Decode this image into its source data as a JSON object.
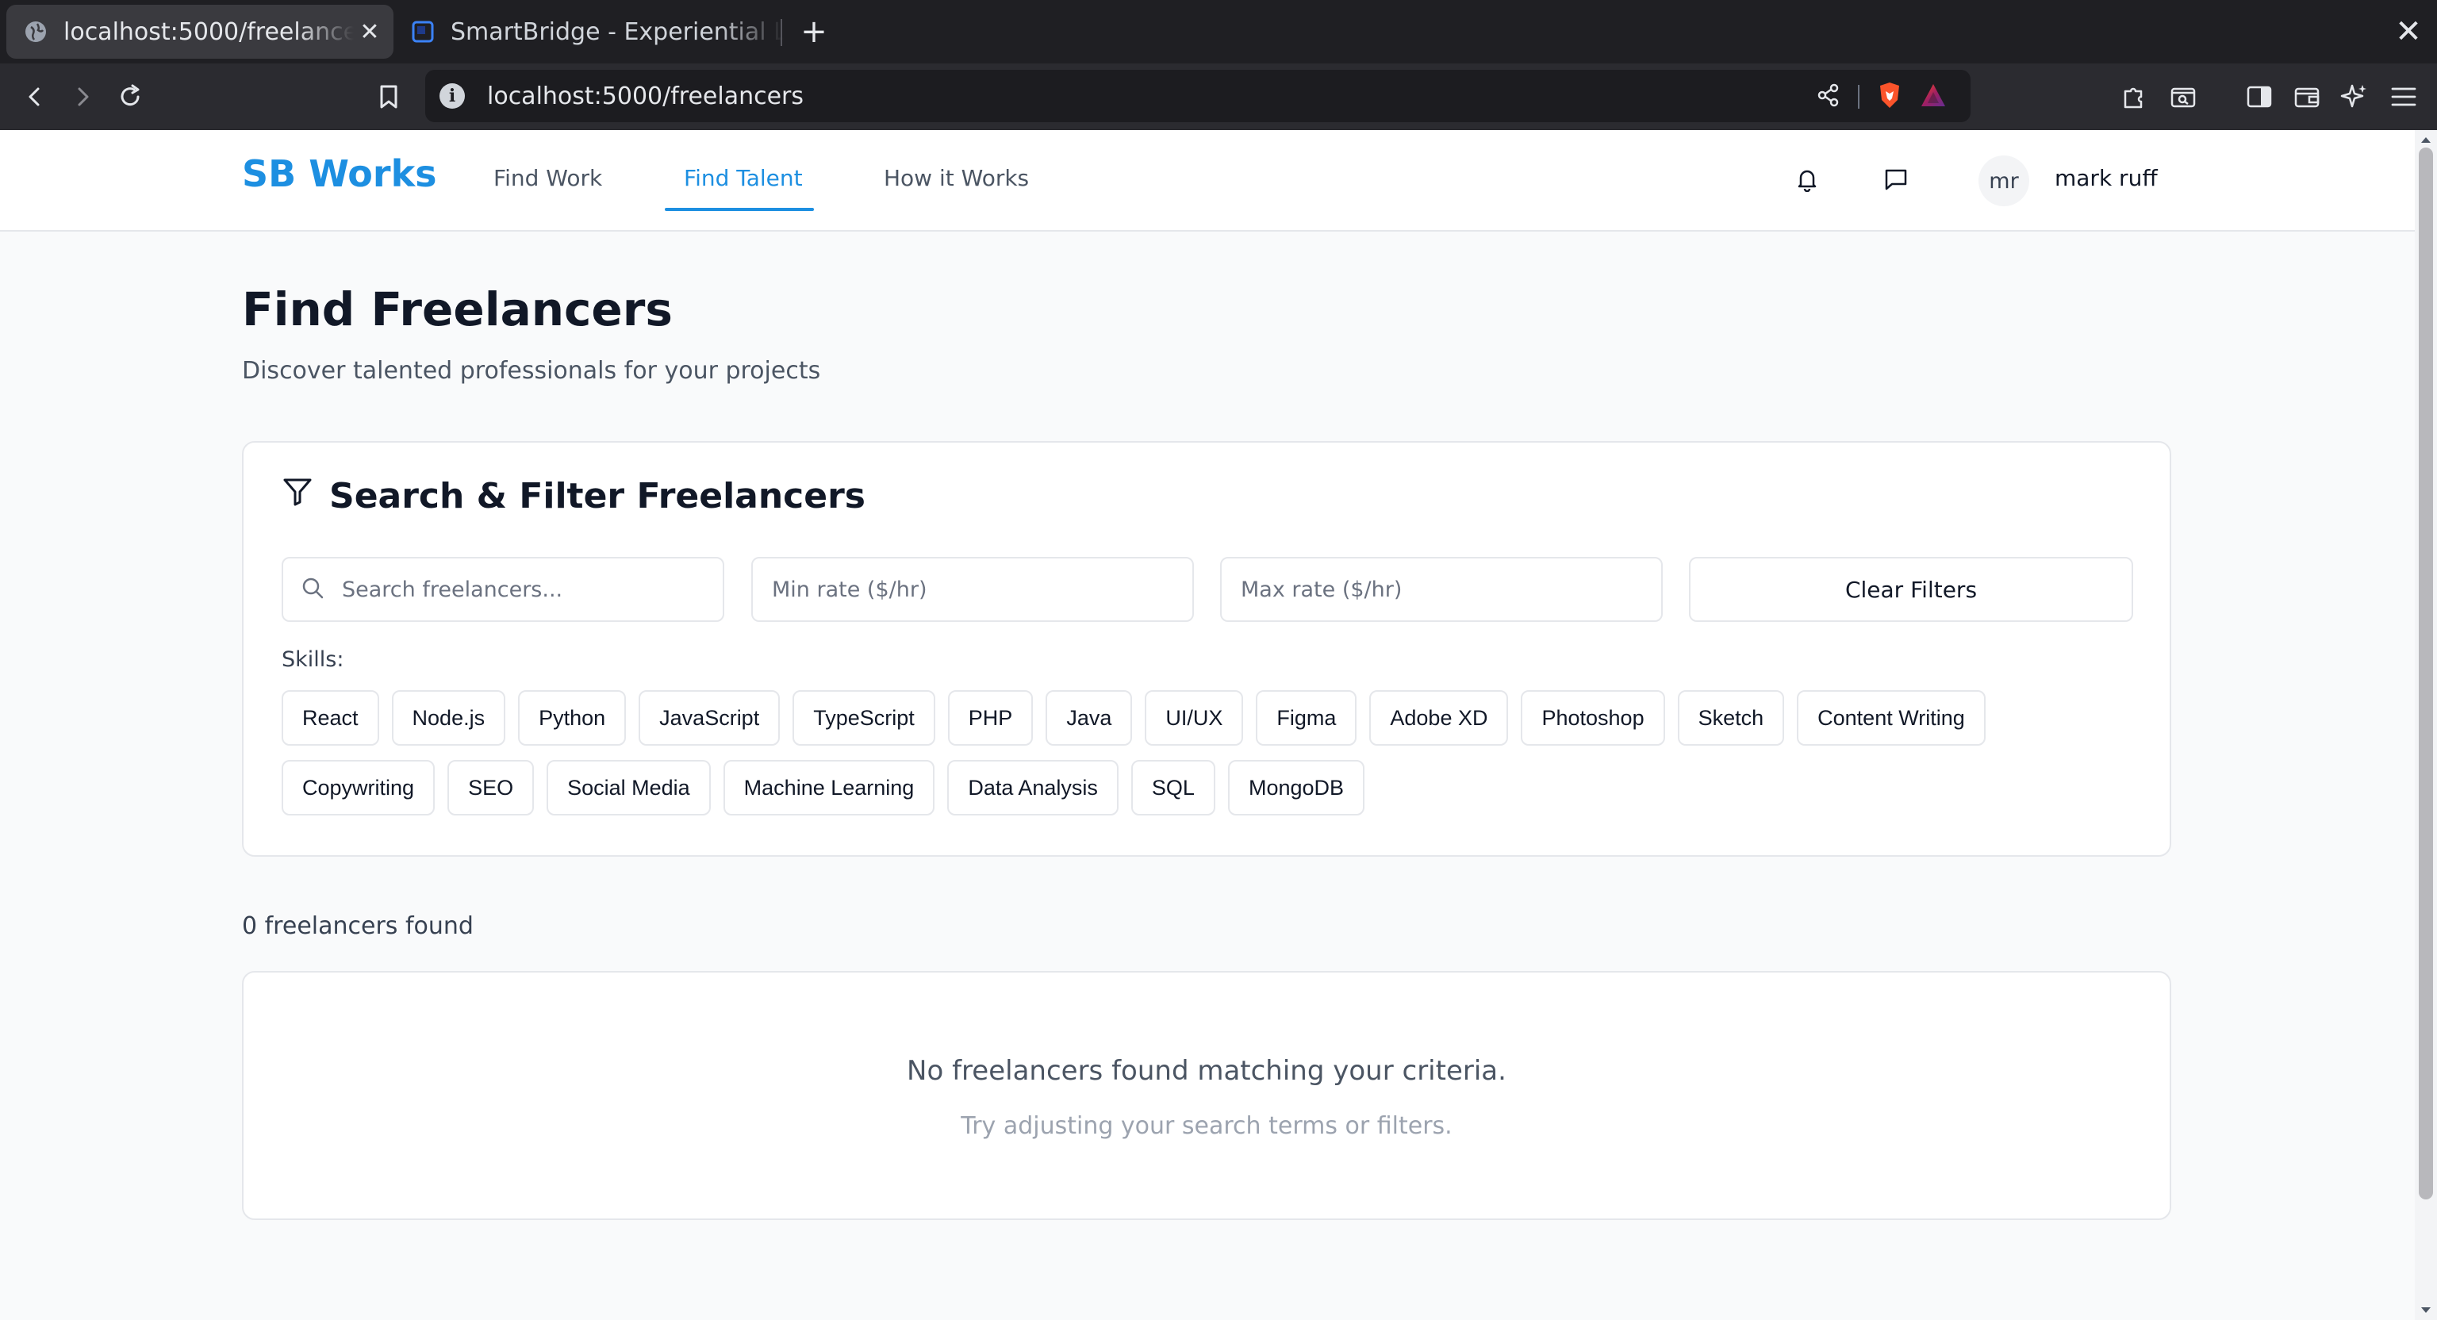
{
  "browser": {
    "tabs": [
      {
        "title": "localhost:5000/freelancers",
        "active": true,
        "favicon": "globe-icon"
      },
      {
        "title": "SmartBridge - Experiential Learning",
        "active": false,
        "favicon": "smartbridge-icon"
      }
    ],
    "url": "localhost:5000/freelancers"
  },
  "app": {
    "logo": "SB Works",
    "nav": [
      {
        "label": "Find Work",
        "active": false
      },
      {
        "label": "Find Talent",
        "active": true
      },
      {
        "label": "How it Works",
        "active": false
      }
    ],
    "user": {
      "initials": "mr",
      "name": "mark ruff"
    }
  },
  "page": {
    "title": "Find Freelancers",
    "subtitle": "Discover talented professionals for your projects"
  },
  "filters": {
    "title": "Search & Filter Freelancers",
    "search_placeholder": "Search freelancers...",
    "min_rate_placeholder": "Min rate ($/hr)",
    "max_rate_placeholder": "Max rate ($/hr)",
    "clear_label": "Clear Filters",
    "skills_label": "Skills:",
    "skills": [
      "React",
      "Node.js",
      "Python",
      "JavaScript",
      "TypeScript",
      "PHP",
      "Java",
      "UI/UX",
      "Figma",
      "Adobe XD",
      "Photoshop",
      "Sketch",
      "Content Writing",
      "Copywriting",
      "SEO",
      "Social Media",
      "Machine Learning",
      "Data Analysis",
      "SQL",
      "MongoDB"
    ]
  },
  "results": {
    "count_text": "0 freelancers found",
    "empty_title": "No freelancers found matching your criteria.",
    "empty_subtitle": "Try adjusting your search terms or filters."
  },
  "colors": {
    "brand": "#1d8fe1",
    "browser_dark": "#1f1f23",
    "page_bg": "#f9fafb"
  }
}
